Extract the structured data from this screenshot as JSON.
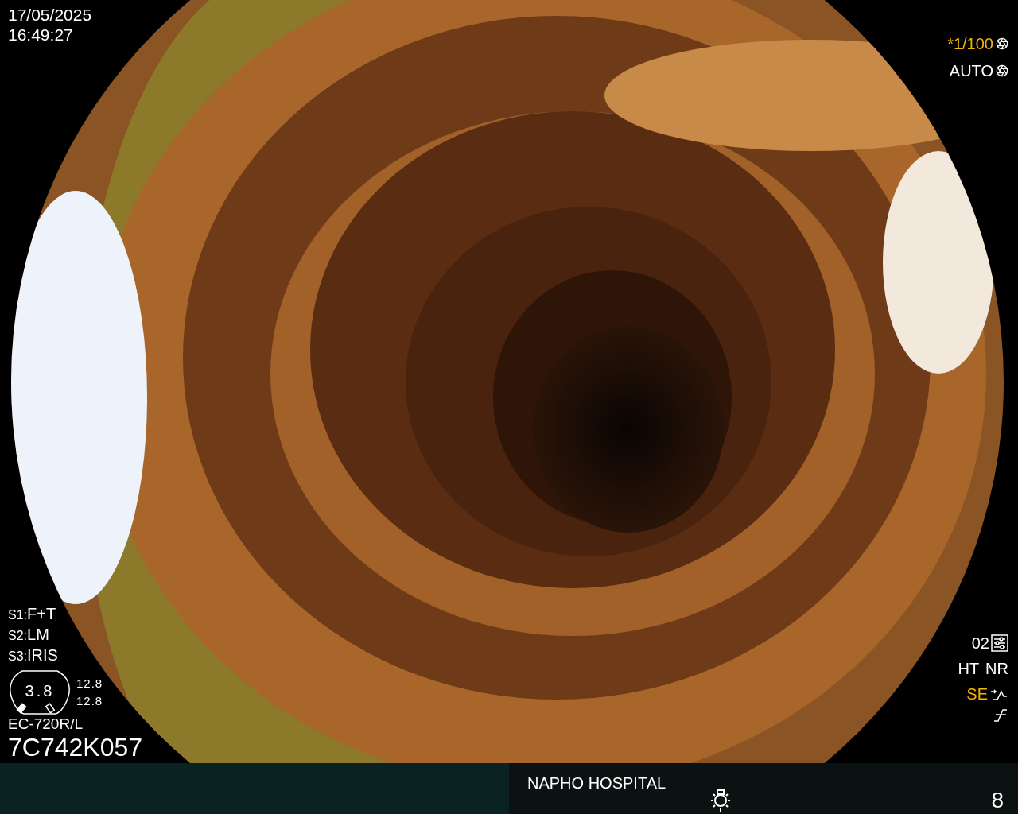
{
  "datetime": {
    "date": "17/05/2025",
    "time": "16:49:27"
  },
  "shutter": {
    "speed": "*1/100",
    "iris": "AUTO"
  },
  "switches": [
    {
      "key": "S1:",
      "value": "F+T"
    },
    {
      "key": "S2:",
      "value": "LM"
    },
    {
      "key": "S3:",
      "value": "IRIS"
    }
  ],
  "zoom_gauge": {
    "value": "3.8",
    "readings": [
      "12.8",
      "12.8"
    ]
  },
  "scope": {
    "model": "EC-720R/L",
    "serial": "7C742K057"
  },
  "image_settings": {
    "preset": "02",
    "modes": [
      "HT",
      "NR"
    ],
    "enhancement": "SE"
  },
  "footer": {
    "hospital": "NAPHO HOSPITAL",
    "counter": "8"
  }
}
